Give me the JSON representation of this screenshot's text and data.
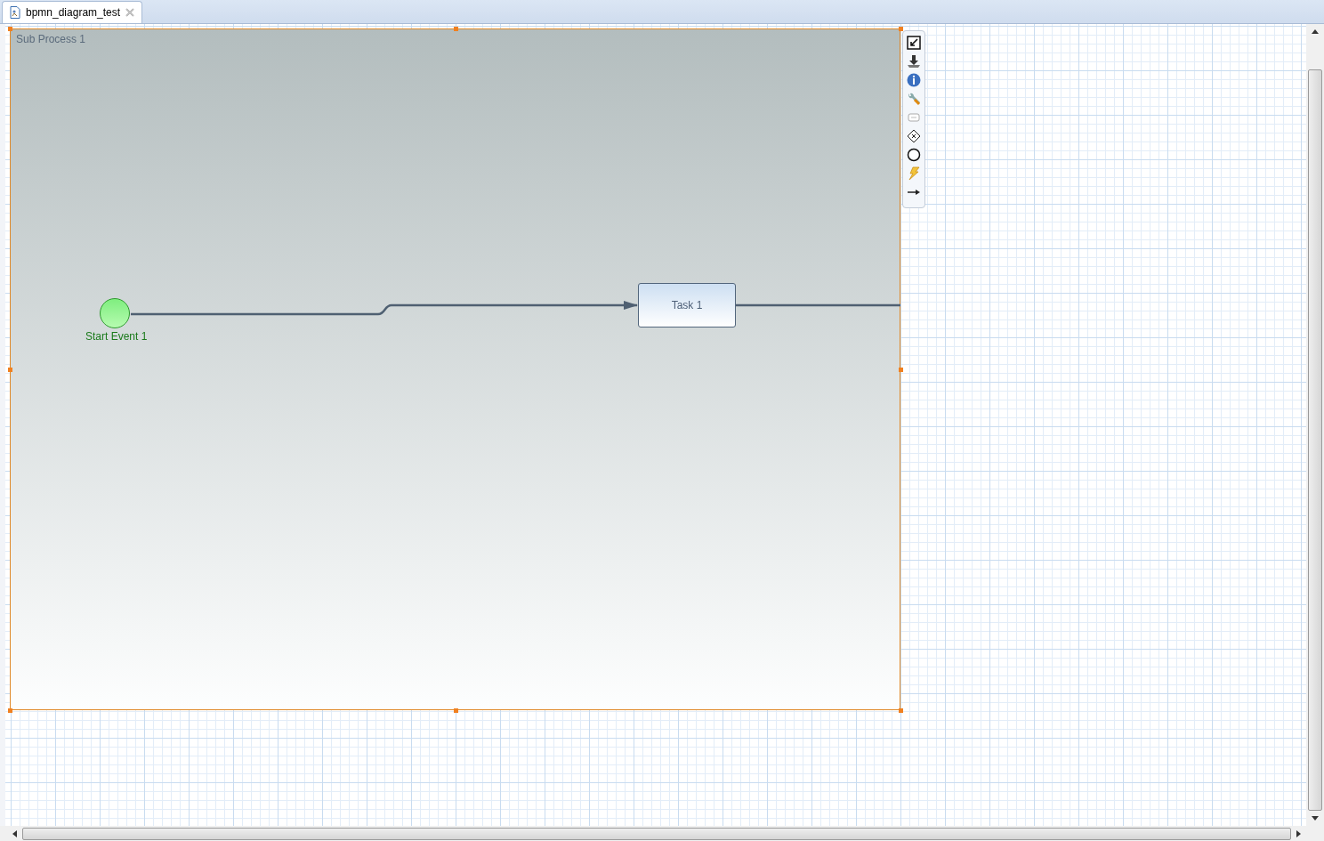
{
  "editor_tab": {
    "title": "bpmn_diagram_test",
    "selected": true
  },
  "diagram": {
    "sub_process": {
      "label": "Sub Process 1",
      "selected": true
    },
    "start_event": {
      "label": "Start Event 1"
    },
    "task": {
      "label": "Task 1"
    }
  }
}
